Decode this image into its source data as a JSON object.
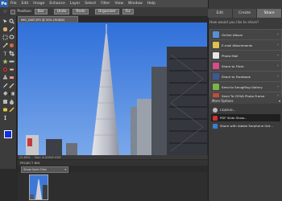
{
  "app": {
    "logo": "Pe"
  },
  "menu": [
    "File",
    "Edit",
    "Image",
    "Enhance",
    "Layer",
    "Select",
    "Filter",
    "View",
    "Window",
    "Help"
  ],
  "options": {
    "position_label": "Position",
    "position_button": "Bar",
    "btn_undo": "Undo",
    "btn_redo": "Redo",
    "btn_organizer": "Organizer",
    "btn_fix": "Fix"
  },
  "document": {
    "tab": "IMG_0487.JPG @ 50% (RGB/8)",
    "status": "22.69%",
    "status_doc": "Doc: 8.02M/8.02M"
  },
  "project_bin": {
    "title": "PROJECT BIN",
    "select": "Show Open Files"
  },
  "panel": {
    "tabs": [
      "Edit",
      "Create",
      "Share"
    ],
    "active_tab": "Share",
    "question": "How would you like to share?",
    "items": [
      {
        "label": "Online Album",
        "icon_color": "#5a8fd6"
      },
      {
        "label": "E-mail Attachments",
        "icon_color": "#e0c050"
      },
      {
        "label": "Photo Mail",
        "icon_color": "#e6e6e6"
      },
      {
        "label": "Share to Flickr",
        "icon_color": "#d94b8c"
      },
      {
        "label": "Share to Facebook",
        "icon_color": "#3b5998"
      },
      {
        "label": "Send to SmugMug Gallery",
        "icon_color": "#7db24a"
      },
      {
        "label": "Send To CEIVA Photo Frame",
        "icon_color": "#c84a3a"
      }
    ],
    "more_header": "More Options",
    "more_items": [
      {
        "label": "CD/DVD...",
        "icon_color": "#bbbbbb",
        "highlight": false
      },
      {
        "label": "PDF Slide Show...",
        "icon_color": "#d03030",
        "highlight": true
      },
      {
        "label": "Share with Adobe Earphone Get...",
        "icon_color": "#3a7fd0",
        "highlight": false
      }
    ]
  }
}
